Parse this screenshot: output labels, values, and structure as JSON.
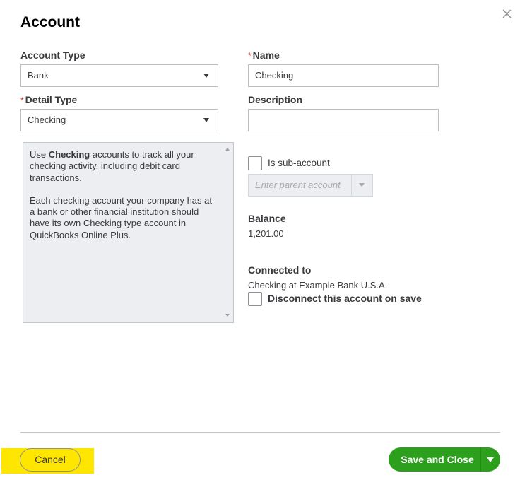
{
  "dialog": {
    "title": "Account",
    "close_icon": "close-icon"
  },
  "form": {
    "account_type": {
      "label": "Account Type",
      "value": "Bank"
    },
    "detail_type": {
      "label": "Detail Type",
      "required_mark": "*",
      "value": "Checking"
    },
    "name": {
      "label": "Name",
      "required_mark": "*",
      "value": "Checking"
    },
    "description": {
      "label": "Description",
      "value": ""
    },
    "help": {
      "prefix": "Use ",
      "bold": "Checking",
      "suffix": " accounts to track all your checking activity, including debit card transactions.",
      "paragraph2": "Each checking account your company has at a bank or other financial institution should have its own Checking type account in QuickBooks Online Plus."
    },
    "sub_account": {
      "label": "Is sub-account",
      "checked": false,
      "parent_placeholder": "Enter parent account"
    },
    "balance": {
      "label": "Balance",
      "value": "1,201.00"
    },
    "connected": {
      "label": "Connected to",
      "value": "Checking at Example Bank U.S.A.",
      "disconnect_label": "Disconnect this account on save",
      "disconnect_checked": false
    }
  },
  "footer": {
    "cancel_label": "Cancel",
    "save_label": "Save and Close",
    "highlight_color": "#ffe600",
    "save_color": "#2ca01c"
  }
}
